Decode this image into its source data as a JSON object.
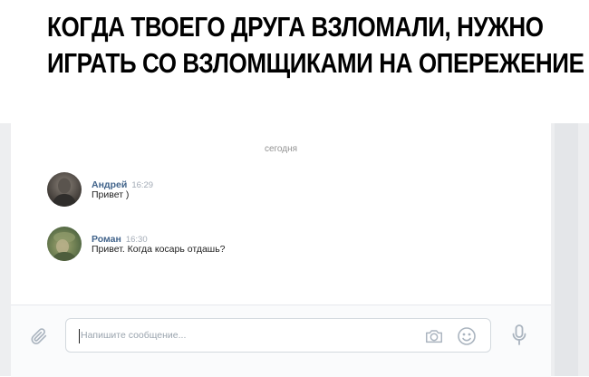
{
  "meme_caption": {
    "line1": "КОГДА ТВОЕГО ДРУГА ВЗЛОМАЛИ, НУЖНО",
    "line2": "ИГРАТЬ СО ВЗЛОМЩИКАМИ НА ОПЕРЕЖЕНИЕ"
  },
  "chat": {
    "date_divider": "сегодня",
    "messages": [
      {
        "author": "Андрей",
        "time": "16:29",
        "text": "Привет )"
      },
      {
        "author": "Роман",
        "time": "16:30",
        "text": "Привет. Когда косарь отдашь?"
      }
    ]
  },
  "composer": {
    "placeholder": "Напишите сообщение...",
    "value": ""
  },
  "icons": {
    "attach": "paperclip-icon",
    "camera": "camera-icon",
    "emoji": "smile-icon",
    "voice": "microphone-icon"
  },
  "colors": {
    "author_name": "#42648b",
    "page_background": "#edeef0",
    "icon_gray": "#aab4bf"
  }
}
